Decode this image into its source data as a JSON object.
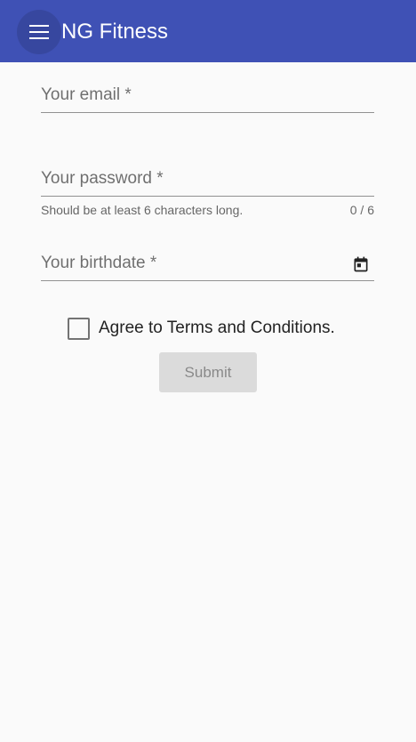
{
  "toolbar": {
    "title": "NG Fitness",
    "menu_icon": "menu-icon",
    "color": "#3f51b5"
  },
  "form": {
    "email": {
      "label": "Your email *",
      "value": ""
    },
    "password": {
      "label": "Your password *",
      "value": "",
      "hint": "Should be at least 6 characters long.",
      "counter": "0 / 6"
    },
    "birthdate": {
      "label": "Your birthdate *",
      "value": "",
      "picker_icon": "calendar-icon"
    },
    "terms": {
      "label": "Agree to Terms and Conditions.",
      "checked": false
    },
    "submit": {
      "label": "Submit",
      "disabled": true
    }
  }
}
